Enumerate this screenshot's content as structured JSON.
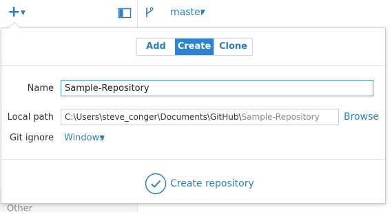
{
  "topbar": {
    "add_icon": "plus-icon",
    "add_caret_icon": "caret-down-icon",
    "sidebar_toggle_icon": "panel-toggle-icon",
    "branch_icon": "git-branch-icon",
    "branch": "master"
  },
  "sidebar": {
    "visible_item": "Other"
  },
  "popover": {
    "tabs": [
      {
        "label": "Add",
        "active": false
      },
      {
        "label": "Create",
        "active": true
      },
      {
        "label": "Clone",
        "active": false
      }
    ],
    "form": {
      "name_label": "Name",
      "name_value": "Sample-Repository",
      "local_path_label": "Local path",
      "local_path_base": "C:\\Users\\steve_conger\\Documents\\GitHub\\",
      "local_path_suffix": "Sample-Repository",
      "browse_label": "Browse",
      "git_ignore_label": "Git ignore",
      "git_ignore_value": "Windows"
    },
    "create_button_label": "Create repository",
    "create_button_icon": "checkmark-circle-icon"
  },
  "colors": {
    "accent": "#2a7fc0",
    "active_tab_bg": "#2a84d2",
    "input_focus_border": "#3b8fd6"
  }
}
